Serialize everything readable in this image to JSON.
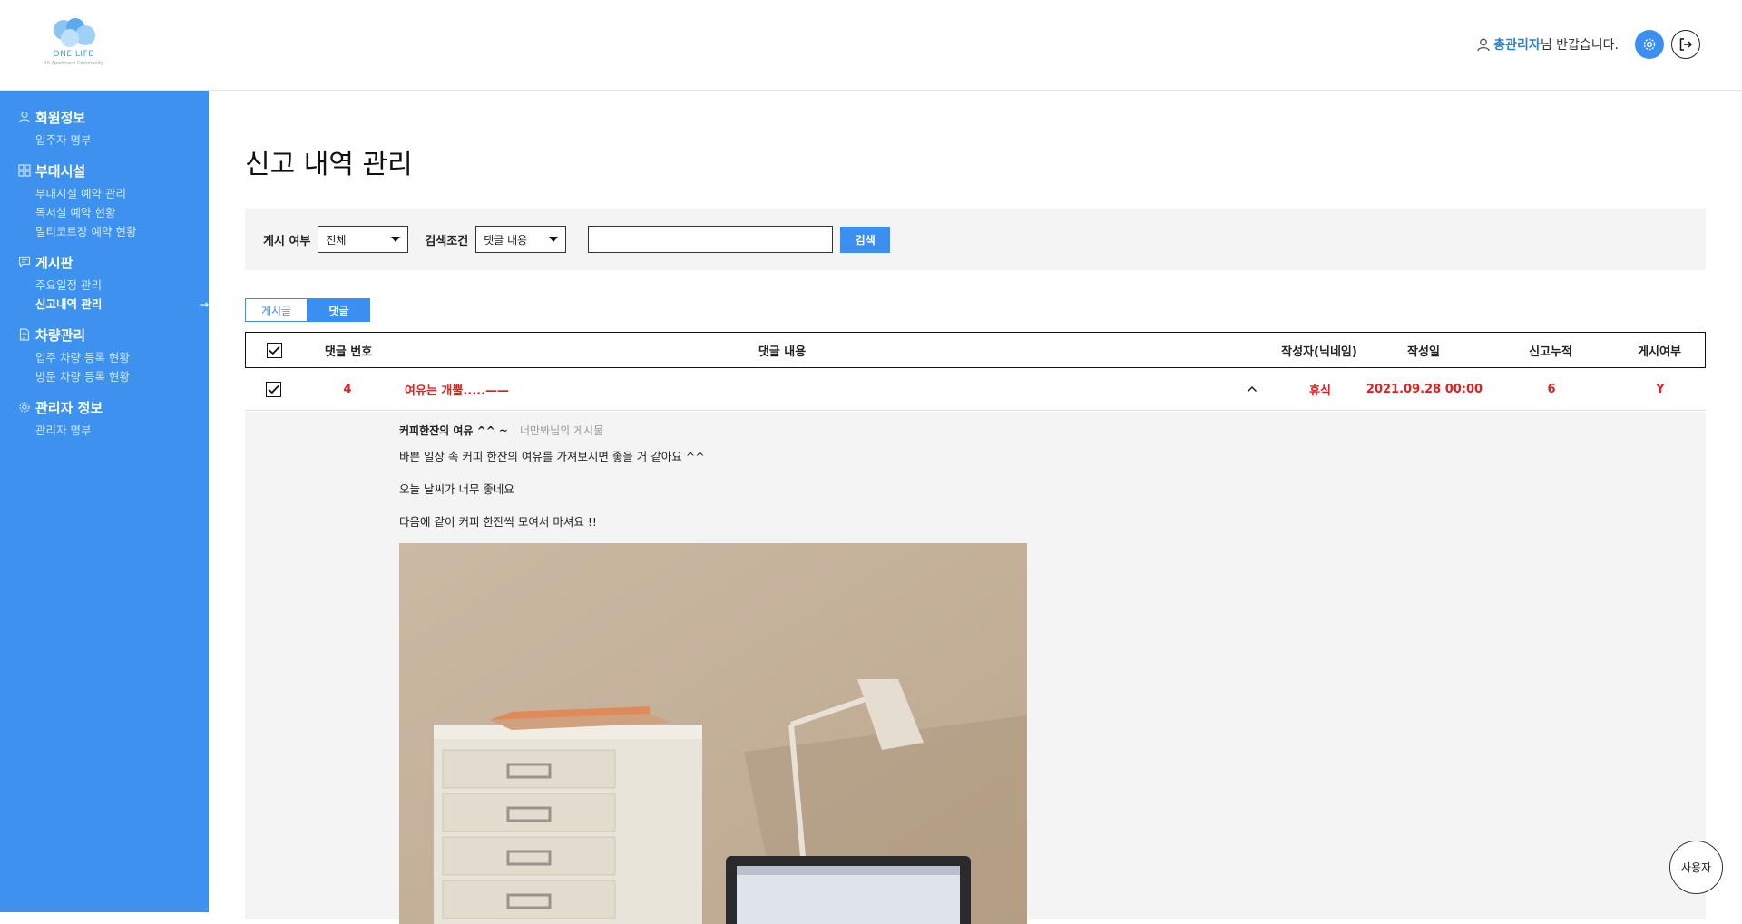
{
  "header": {
    "logo": {
      "name": "ONE LIFE",
      "subtitle": "XX Apartment Community"
    },
    "greeting": {
      "admin_name": "총관리자",
      "suffix": "님 반갑습니다."
    }
  },
  "sidebar": {
    "groups": [
      {
        "title": "회원정보",
        "icon": "user-icon",
        "items": [
          {
            "label": "입주자 명부"
          }
        ]
      },
      {
        "title": "부대시설",
        "icon": "grid-icon",
        "items": [
          {
            "label": "부대시설 예약 관리"
          },
          {
            "label": "독서실 예약 현황"
          },
          {
            "label": "멀티코트장 예약 현황"
          }
        ]
      },
      {
        "title": "게시판",
        "icon": "message-icon",
        "items": [
          {
            "label": "주요일정 관리"
          },
          {
            "label": "신고내역 관리",
            "active": true,
            "arrow": "→"
          }
        ]
      },
      {
        "title": "차량관리",
        "icon": "document-icon",
        "items": [
          {
            "label": "입주 차량 등록 현황"
          },
          {
            "label": "방문 차량 등록 현황"
          }
        ]
      },
      {
        "title": "관리자 정보",
        "icon": "gear-icon",
        "items": [
          {
            "label": "관리자 명부"
          }
        ]
      }
    ]
  },
  "main": {
    "title": "신고 내역 관리",
    "search": {
      "posted_label": "게시 여부",
      "posted_value": "전체",
      "condition_label": "검색조건",
      "condition_value": "댓글 내용",
      "keyword_value": "",
      "button_label": "검색"
    },
    "tabs": [
      {
        "label": "게시글",
        "active": false
      },
      {
        "label": "댓글",
        "active": true
      }
    ],
    "table": {
      "headers": {
        "number": "댓글 번호",
        "content": "댓글 내용",
        "author": "작성자(닉네임)",
        "date": "작성일",
        "reports": "신고누적",
        "posted": "게시여부"
      },
      "rows": [
        {
          "number": "4",
          "content": "여유는 개뿔.....——",
          "toggle": "^",
          "author": "휴식",
          "date": "2021.09.28 00:00",
          "reports": "6",
          "posted": "Y"
        }
      ]
    },
    "detail": {
      "post_title": "커피한잔의 여유 ^^ ~",
      "post_author": "너만봐님의 게시물",
      "lines": [
        "바쁜 일상 속 커피 한잔의 여유를 가져보시면 좋을 거 같아요 ^^",
        "오늘 날씨가 너무 좋네요",
        "다음에 같이 커피 한잔씩 모여서 마셔요 !!"
      ]
    }
  },
  "floating": {
    "user_button": "사용자"
  },
  "colors": {
    "accent": "#3a8ff0",
    "sidebar": "#3c92ee",
    "alert": "#e12020"
  }
}
